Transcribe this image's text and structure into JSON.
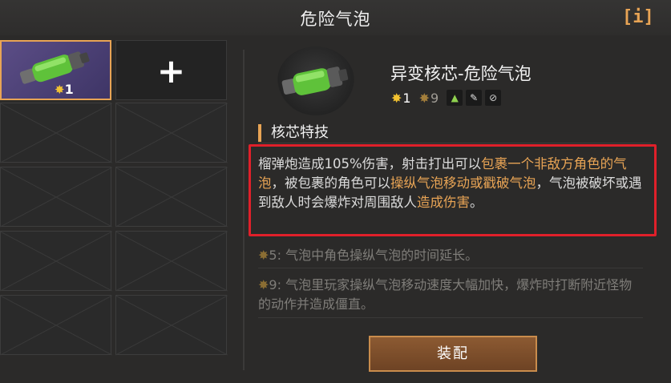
{
  "header": {
    "title": "危险气泡",
    "info_label": "[i]"
  },
  "inventory": {
    "selected_level": "1",
    "add_label": "+"
  },
  "detail": {
    "name": "异变核芯-危险气泡",
    "stat_level": "1",
    "stat_max": "9",
    "tags": [
      "element-icon",
      "wrench-icon",
      "block-icon"
    ]
  },
  "skill": {
    "section_title": "核芯特技",
    "description": {
      "p1": "榴弹炮造成105%伤害，射击打出可以",
      "h1": "包裹一个非敌方角色的气泡",
      "p2": "，被包裹的角色可以",
      "h2": "操纵气泡移动或戳破气泡",
      "p3": "，气泡被破坏或遇到敌人时会爆炸对周围敌人",
      "h3": "造成伤害",
      "p4": "。"
    },
    "bonus5_level": "5",
    "bonus5_text": ": 气泡中角色操纵气泡的时间延长。",
    "bonus9_level": "9",
    "bonus9_text": ": 气泡里玩家操纵气泡移动速度大幅加快，爆炸时打断附近怪物的动作并造成僵直。"
  },
  "actions": {
    "equip_label": "装配"
  },
  "colors": {
    "accent": "#e8a455",
    "highlight_border": "#e0202a",
    "selected_slot": "#5b4d86"
  }
}
